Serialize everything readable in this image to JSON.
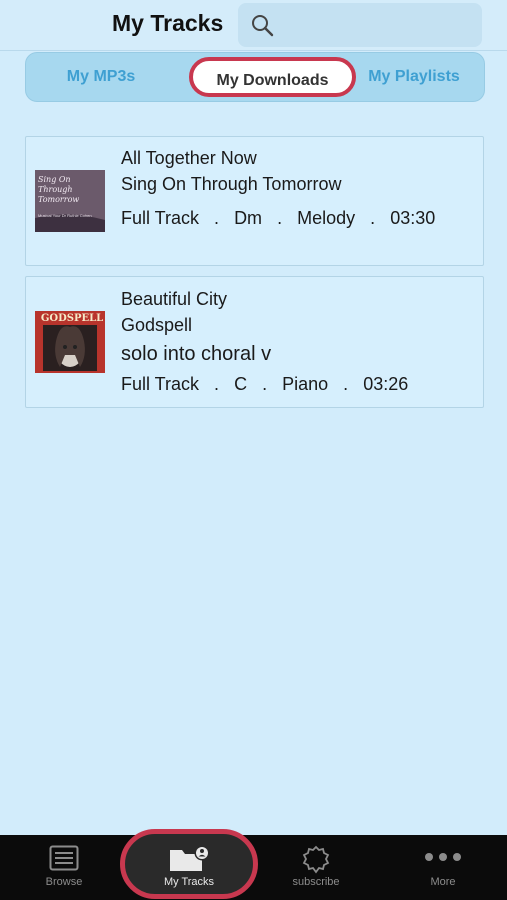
{
  "header": {
    "title": "My Tracks"
  },
  "segments": [
    {
      "label": "My MP3s",
      "active": false
    },
    {
      "label": "My Downloads",
      "active": true
    },
    {
      "label": "My Playlists",
      "active": false
    }
  ],
  "tracks": [
    {
      "title": "All Together Now",
      "album": "Sing On Through Tomorrow",
      "note": "",
      "meta": {
        "type": "Full Track",
        "key": "Dm",
        "instrument": "Melody",
        "duration": "03:30"
      },
      "art": {
        "text": "Sing On Through Tomorrow",
        "subtext": "Musical Your Dr Ruthie Cohen"
      }
    },
    {
      "title": "Beautiful City",
      "album": "Godspell",
      "note": "solo into choral v",
      "meta": {
        "type": "Full Track",
        "key": "C",
        "instrument": "Piano",
        "duration": "03:26"
      },
      "art": {
        "text": "GODSPELL"
      }
    }
  ],
  "tabbar": {
    "items": [
      {
        "label": "Browse",
        "icon": "browse-icon"
      },
      {
        "label": "My Tracks",
        "icon": "folder-user-icon",
        "active": true
      },
      {
        "label": "subscribe",
        "icon": "subscribe-badge-icon"
      },
      {
        "label": "More",
        "icon": "more-dots-icon"
      }
    ]
  },
  "colors": {
    "background": "#d2ecfb",
    "accent": "#3fa0d2",
    "highlight_ring": "#c8384f",
    "tabbar": "#0b0b0b"
  },
  "separator": "."
}
